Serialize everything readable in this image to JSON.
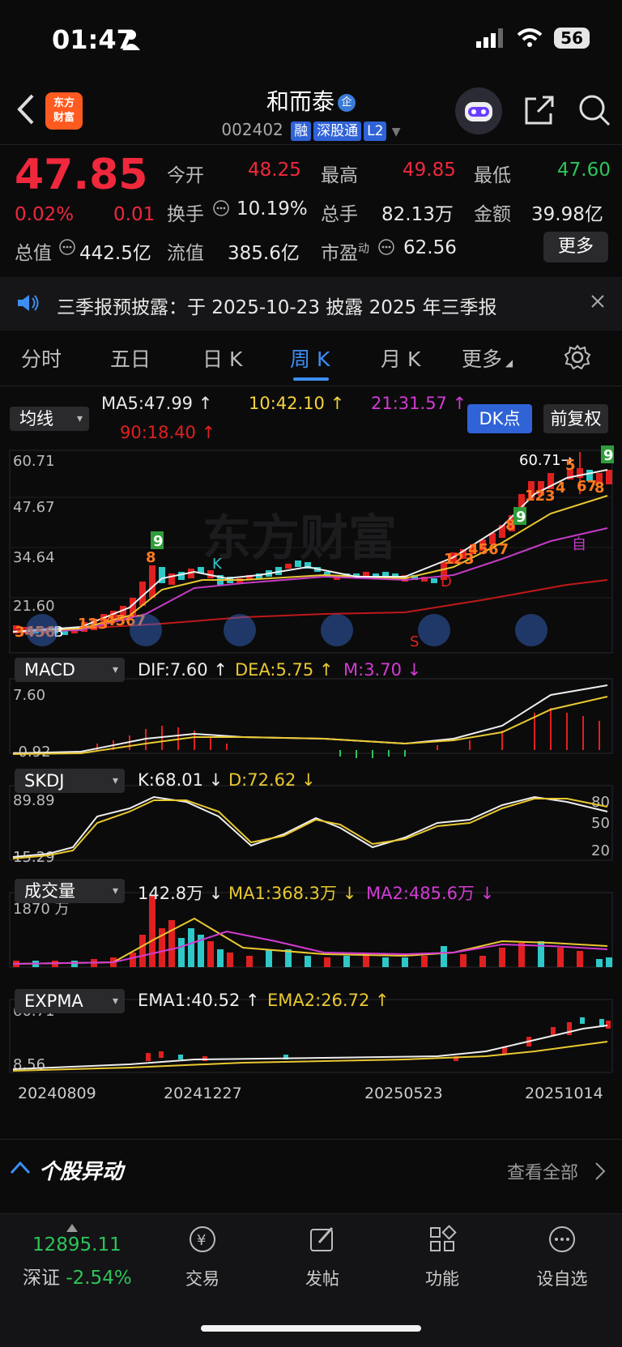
{
  "status": {
    "time": "01:47",
    "battery": "56"
  },
  "header": {
    "logo_text": "东方财富",
    "stock_name": "和而泰",
    "badge": "企",
    "code": "002402",
    "tags": [
      "融",
      "深股通",
      "L2"
    ]
  },
  "quote": {
    "price": "47.85",
    "change_pct": "0.02%",
    "change_abs": "0.01",
    "fields": [
      {
        "label": "今开",
        "value": "48.25"
      },
      {
        "label": "最高",
        "value": "49.85"
      },
      {
        "label": "最低",
        "value": "47.60"
      },
      {
        "label": "换手",
        "value": "10.19%"
      },
      {
        "label": "总手",
        "value": "82.13万"
      },
      {
        "label": "金额",
        "value": "39.98亿"
      },
      {
        "label": "总值",
        "value": "442.5亿"
      },
      {
        "label": "流值",
        "value": "385.6亿"
      },
      {
        "label": "市盈",
        "value": "62.56"
      }
    ],
    "pe_sup": "动",
    "more_button": "更多"
  },
  "notice": {
    "text": "三季报预披露：于 2025-10-23 披露 2025 年三季报"
  },
  "tabs": [
    "分时",
    "五日",
    "日 K",
    "周 K",
    "月 K",
    "更多"
  ],
  "active_tab": "周 K",
  "main_chart": {
    "indicator_select": "均线",
    "ma5": "MA5:47.99 ↑",
    "ma10": "10:42.10 ↑",
    "ma21": "21:31.57 ↑",
    "ma90": "90:18.40 ↑",
    "dk_button": "DK点",
    "adjust_button": "前复权",
    "y_ticks": [
      "60.71",
      "47.67",
      "34.64",
      "21.60"
    ],
    "max_label": "60.71→",
    "watermark": "东方财富",
    "markers": [
      "K",
      "B",
      "S",
      "D",
      "自"
    ]
  },
  "macd": {
    "select": "MACD",
    "dif": "DIF:7.60 ↑",
    "dea": "DEA:5.75 ↑",
    "m": "M:3.70 ↓",
    "y_top": "7.60",
    "y_bottom": "-0.92"
  },
  "skdj": {
    "select": "SKDJ",
    "k": "K:68.01 ↓",
    "d": "D:72.62 ↓",
    "y_top": "89.89",
    "y_bottom": "15.29",
    "levels": [
      "80",
      "50",
      "20"
    ]
  },
  "volume": {
    "select": "成交量",
    "vol": "142.8万 ↓",
    "ma1": "MA1:368.3万 ↓",
    "ma2": "MA2:485.6万 ↓",
    "y_top": "1870 万"
  },
  "expma": {
    "select": "EXPMA",
    "ema1": "EMA1:40.52 ↑",
    "ema2": "EMA2:26.72 ↑",
    "y_top": "60.71",
    "y_bottom": "8.56"
  },
  "x_dates": [
    "20240809",
    "20241227",
    "20250523",
    "20251014"
  ],
  "section": {
    "title": "个股异动",
    "view_all": "查看全部"
  },
  "bottom_nav": {
    "index_value": "12895.11",
    "index_name": "深证",
    "index_change": "-2.54%",
    "items": [
      "交易",
      "发帖",
      "功能",
      "设自选"
    ]
  }
}
